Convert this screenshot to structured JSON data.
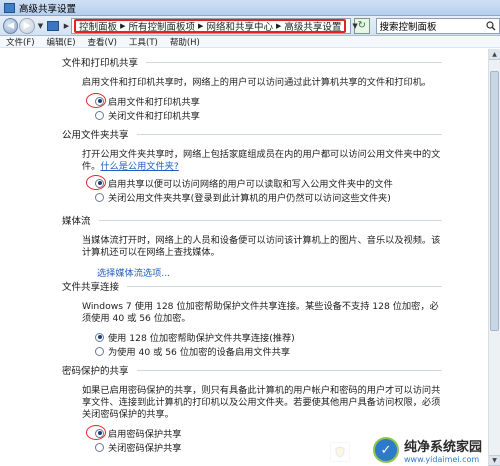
{
  "window": {
    "title": "高级共享设置"
  },
  "nav": {
    "breadcrumbs": [
      "控制面板",
      "所有控制面板项",
      "网络和共享中心",
      "高级共享设置"
    ],
    "search_placeholder": "搜索控制面板"
  },
  "menu": [
    "文件(F)",
    "编辑(E)",
    "查看(V)",
    "工具(T)",
    "帮助(H)"
  ],
  "sections": {
    "file_printer": {
      "title": "文件和打印机共享",
      "desc": "启用文件和打印机共享时，网络上的用户可以访问通过此计算机共享的文件和打印机。",
      "opt1": "启用文件和打印机共享",
      "opt2": "关闭文件和打印机共享",
      "selected": 1
    },
    "public_folder": {
      "title": "公用文件夹共享",
      "desc": "打开公用文件夹共享时，网络上包括家庭组成员在内的用户都可以访问公用文件夹中的文件。",
      "link": "什么是公用文件夹?",
      "opt1": "启用共享以便可以访问网络的用户可以读取和写入公用文件夹中的文件",
      "opt2": "关闭公用文件夹共享(登录到此计算机的用户仍然可以访问这些文件夹)",
      "selected": 1
    },
    "media": {
      "title": "媒体流",
      "desc": "当媒体流打开时，网络上的人员和设备便可以访问该计算机上的图片、音乐以及视频。该计算机还可以在网络上查找媒体。",
      "link": "选择媒体流选项..."
    },
    "file_sharing": {
      "title": "文件共享连接",
      "desc": "Windows 7 使用 128 位加密帮助保护文件共享连接。某些设备不支持 128 位加密，必须使用 40 或 56 位加密。",
      "opt1": "使用 128 位加密帮助保护文件共享连接(推荐)",
      "opt2": "为使用 40 或 56 位加密的设备启用文件共享",
      "selected": 1
    },
    "password": {
      "title": "密码保护的共享",
      "desc": "如果已启用密码保护的共享，则只有具备此计算机的用户帐户和密码的用户才可以访问共享文件、连接到此计算机的打印机以及公用文件夹。若要使其他用户具备访问权限，必须关闭密码保护的共享。",
      "opt1": "启用密码保护共享",
      "opt2": "关闭密码保护共享",
      "selected": 1
    }
  },
  "watermark": {
    "title": "纯净系统家园",
    "url": "www.yidaimei.com"
  }
}
